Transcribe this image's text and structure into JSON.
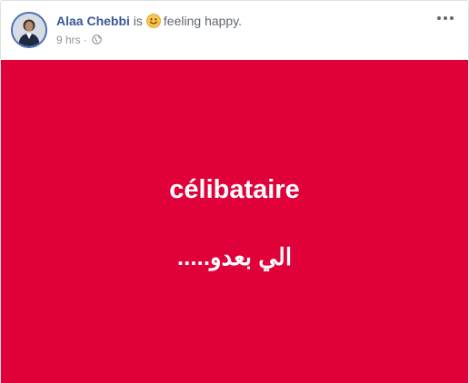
{
  "post": {
    "author": "Alaa Chebbi",
    "verb": "is",
    "feeling_icon": "smiley-emoji",
    "feeling_text": "feeling happy.",
    "time": "9 hrs",
    "separator": "·",
    "privacy_icon": "globe-icon",
    "options_icon": "more-options-icon"
  },
  "content": {
    "background_color": "#e0003a",
    "line1": "célibataire",
    "line2": "الي بعدو....."
  }
}
